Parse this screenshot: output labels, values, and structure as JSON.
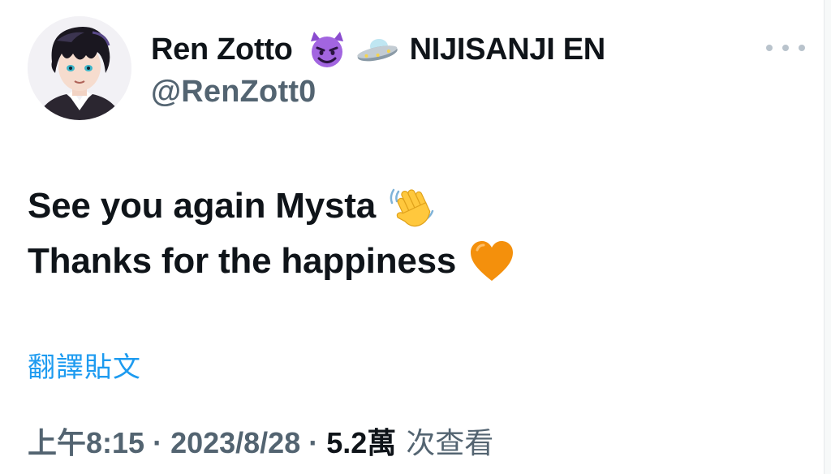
{
  "author": {
    "display_name": "Ren Zotto",
    "name_emojis": [
      "smiling-devil-emoji",
      "flying-saucer-emoji"
    ],
    "affiliation": "NIJISANJI EN",
    "handle": "@RenZott0"
  },
  "tweet": {
    "line1": "See you again Mysta",
    "line1_emoji": "waving-hand-emoji",
    "line2": "Thanks for the happiness",
    "line2_emoji": "orange-heart-emoji"
  },
  "translate_label": "翻譯貼文",
  "meta": {
    "time": "上午8:15",
    "date": "2023/8/28",
    "views_count": "5.2萬",
    "views_label": "次查看"
  },
  "colors": {
    "text": "#0f1419",
    "secondary": "#536471",
    "link": "#1d9bf0",
    "devil": "#8a4bcf",
    "heart": "#f4900c",
    "wave": "#ffc83d"
  },
  "icons": {
    "more": "more-dots-icon"
  }
}
